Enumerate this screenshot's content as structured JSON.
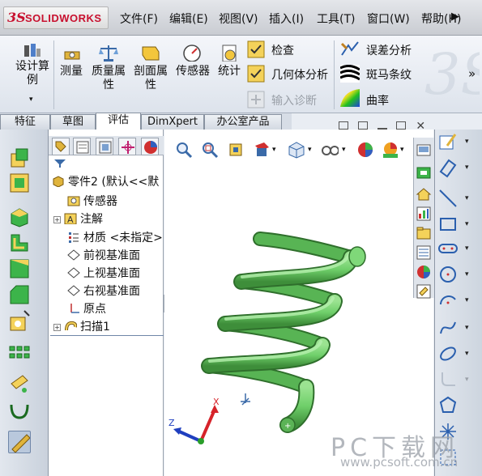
{
  "app": {
    "brand": "SOLIDWORKS",
    "brand_prefix": "3S"
  },
  "menu": {
    "items": [
      "文件(F)",
      "编辑(E)",
      "视图(V)",
      "插入(I)",
      "工具(T)",
      "窗口(W)",
      "帮助(H)"
    ],
    "overflow": "▶"
  },
  "ribbon": {
    "design_study": "设计算例",
    "measure": "测量",
    "mass_props": "质量属性",
    "section_props": "剖面属性",
    "sensor": "传感器",
    "statistics": "统计",
    "check": "检查",
    "geometry_analysis": "几何体分析",
    "import_diagnostics": "输入诊断",
    "deviation_analysis": "误差分析",
    "zebra_stripes": "斑马条纹",
    "curvature": "曲率",
    "expand": "»"
  },
  "tabs": [
    "特征",
    "草图",
    "评估",
    "DimXpert",
    "办公室产品"
  ],
  "active_tab": "评估",
  "feature_tree": {
    "root": "零件2 (默认<<默",
    "items": [
      {
        "label": "传感器",
        "icon": "sensor-folder-icon",
        "expandable": false
      },
      {
        "label": "注解",
        "icon": "annotation-icon",
        "expandable": true
      },
      {
        "label": "材质 <未指定>",
        "icon": "material-icon",
        "expandable": false
      },
      {
        "label": "前视基准面",
        "icon": "plane-icon",
        "expandable": false
      },
      {
        "label": "上视基准面",
        "icon": "plane-icon",
        "expandable": false
      },
      {
        "label": "右视基准面",
        "icon": "plane-icon",
        "expandable": false
      },
      {
        "label": "原点",
        "icon": "origin-icon",
        "expandable": false
      },
      {
        "label": "扫描1",
        "icon": "sweep-icon",
        "expandable": true
      }
    ]
  },
  "triad": {
    "x": "X",
    "y": "Y",
    "z": "Z"
  },
  "watermark": {
    "text": "PC下载网",
    "url": "www.pcsoft.com.cn"
  },
  "colors": {
    "spring": "#6fcf6a",
    "brand_red": "#c8102e",
    "triad_x": "#d6232a",
    "triad_y": "#2a9e2a",
    "triad_z": "#1f3fbf"
  }
}
